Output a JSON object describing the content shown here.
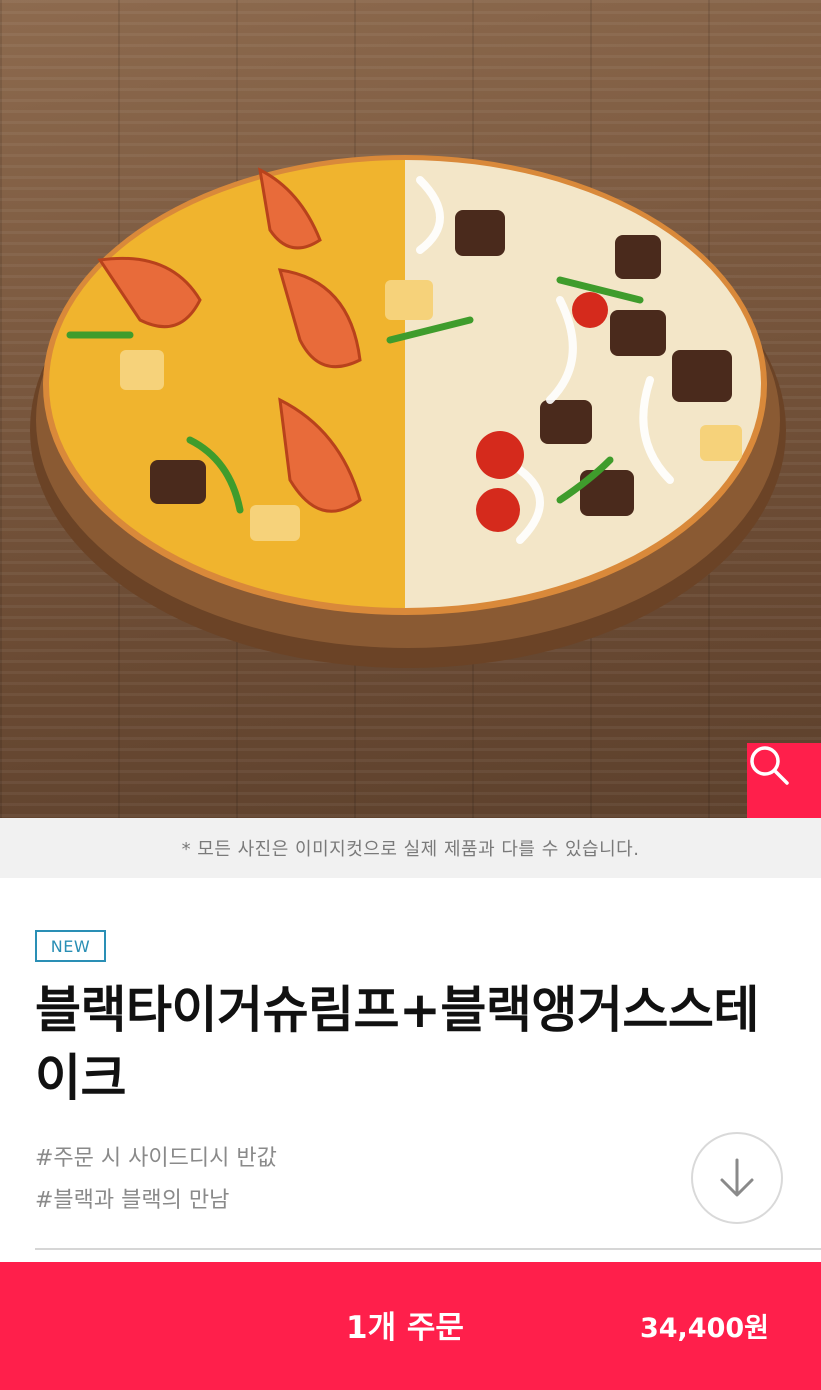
{
  "hero": {
    "image": "pizza-photo",
    "zoom_icon": "search-icon"
  },
  "disclaimer": "* 모든 사진은 이미지컷으로 실제 제품과 다를 수 있습니다.",
  "product": {
    "badge": "NEW",
    "title": "블랙타이거슈림프+블랙앵거스스테이크",
    "tags": [
      "#주문 시 사이드디시 반값",
      "#블랙과 블랙의 만남"
    ],
    "scroll_icon": "arrow-down-icon"
  },
  "order": {
    "label": "1개 주문",
    "price": "34,400원"
  },
  "colors": {
    "accent": "#ff1f4b",
    "badge": "#2a8fb5"
  }
}
